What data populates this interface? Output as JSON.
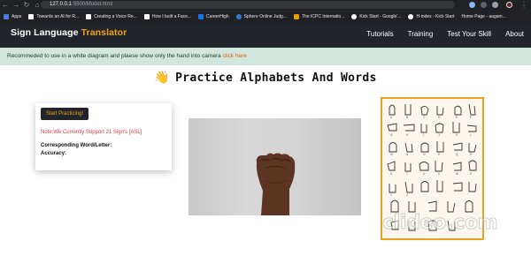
{
  "browser": {
    "url_host": "127.0.0.1",
    "url_path": ":5500/Model.html",
    "bookmarks": [
      {
        "label": "Apps",
        "color": "#4a7bd8"
      },
      {
        "label": "Towards an AI for R...",
        "color": "#ffffff"
      },
      {
        "label": "Creating a Voice Re...",
        "color": "#ffffff"
      },
      {
        "label": "How I built a Face...",
        "color": "#ffffff"
      },
      {
        "label": "CareerHigh",
        "color": "#1a73e8"
      },
      {
        "label": "Sphere Online Judg...",
        "color": "#2e7bd6"
      },
      {
        "label": "The ICPC Internatio...",
        "color": "#e8a000"
      },
      {
        "label": "Kick Start - Google'...",
        "color": "#ffffff"
      },
      {
        "label": "H-index - Kick Start",
        "color": "#ffffff"
      },
      {
        "label": "Home Page - aagam...",
        "color": "#ffffff"
      }
    ]
  },
  "navbar": {
    "brand_main": "Sign Language ",
    "brand_accent": "Translator",
    "links": [
      "Tutorials",
      "Training",
      "Test Your Skill",
      "About"
    ]
  },
  "notice": {
    "text": "Recommeded to use in a white diagram and plaese show only the hand into camera ",
    "link": "click here"
  },
  "heading": {
    "icon": "waving-hand-icon",
    "text": "Practice Alphabets And Words"
  },
  "card": {
    "button": "Start Practicing!",
    "note": "Note:We Currently Support 21 Sign's [ASL]",
    "word_label": "Corresponding Word/Letter:",
    "accuracy_label": "Accuracy:"
  },
  "watermark": "clideo.com",
  "colors": {
    "accent": "#f0a020",
    "navbar": "#212529",
    "notice_bg": "#d1e7dd",
    "note_red": "#dc3545"
  }
}
